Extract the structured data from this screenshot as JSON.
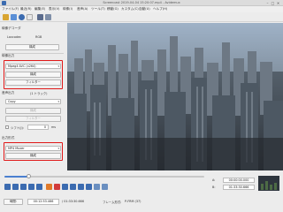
{
  "window": {
    "title": "Screencast 2019-04-04 15:20:07.mp4 - Avidemux",
    "close_glyph": "✕",
    "max_glyph": "□",
    "min_glyph": "–"
  },
  "menu": [
    "ファイル(F)",
    "最近(R)",
    "編集(E)",
    "表示(V)",
    "映像(I)",
    "音声(A)",
    "ツール(T)",
    "移動(G)",
    "カスタム(C)",
    "自動(U)",
    "ヘルプ(H)"
  ],
  "left": {
    "decoder_title": "映像デコーダ",
    "lavcodec": "Lavcodec",
    "rgb": "RGB",
    "decoder_config": "構成",
    "video_output_title": "映像出力",
    "video_codec": "Mpeg4 AVC (x264)",
    "video_config": "構成",
    "video_filter": "フィルター",
    "audio_output_title": "音声出力",
    "audio_tracks": "(1 トラック)",
    "audio_codec": "Copy",
    "audio_config": "構成",
    "audio_filter": "フィルター",
    "shift_label": "シフト(J):",
    "shift_value": "0",
    "shift_unit": "ms",
    "format_title": "出力形式",
    "muxer": "MP4 Muxer",
    "muxer_config": "構成"
  },
  "player": {
    "progress": 0.12,
    "a_label": "A:",
    "b_label": "B:",
    "a_time": "00:00:00.000",
    "b_time": "01:33:30.666",
    "selection_label": "Selection:",
    "selection_time": "01:33:30.666"
  },
  "status": {
    "time_button": "時間:",
    "current_time": "00:12:53.466",
    "total_time": "/ 01:33:30.666",
    "frame_type_label": "フレーム形式:",
    "frame_type": "P-FRM (37)"
  },
  "colors": {
    "accent": "#4a7fd0",
    "highlight": "#e01818"
  }
}
